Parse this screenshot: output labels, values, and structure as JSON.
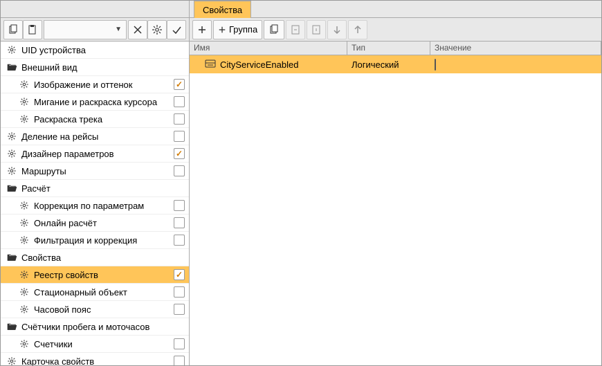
{
  "tabs": {
    "properties": "Свойства"
  },
  "leftToolbar": {
    "comboValue": ""
  },
  "rightToolbar": {
    "group": "Группа"
  },
  "tree": [
    {
      "icon": "gear",
      "label": "UID устройства",
      "indent": 0,
      "chk": null
    },
    {
      "icon": "folder-open",
      "label": "Внешний вид",
      "indent": 0,
      "chk": null
    },
    {
      "icon": "gear",
      "label": "Изображение и оттенок",
      "indent": 1,
      "chk": true
    },
    {
      "icon": "gear",
      "label": "Мигание и раскраска курсора",
      "indent": 1,
      "chk": false
    },
    {
      "icon": "gear",
      "label": "Раскраска трека",
      "indent": 1,
      "chk": false
    },
    {
      "icon": "gear",
      "label": "Деление на рейсы",
      "indent": 0,
      "chk": false
    },
    {
      "icon": "gear",
      "label": "Дизайнер параметров",
      "indent": 0,
      "chk": true
    },
    {
      "icon": "gear",
      "label": "Маршруты",
      "indent": 0,
      "chk": false
    },
    {
      "icon": "folder-open",
      "label": "Расчёт",
      "indent": 0,
      "chk": null
    },
    {
      "icon": "gear",
      "label": "Коррекция по параметрам",
      "indent": 1,
      "chk": false
    },
    {
      "icon": "gear",
      "label": "Онлайн расчёт",
      "indent": 1,
      "chk": false
    },
    {
      "icon": "gear",
      "label": "Фильтрация и коррекция",
      "indent": 1,
      "chk": false
    },
    {
      "icon": "folder-open",
      "label": "Свойства",
      "indent": 0,
      "chk": null
    },
    {
      "icon": "gear",
      "label": "Реестр свойств",
      "indent": 1,
      "chk": true,
      "selected": true
    },
    {
      "icon": "gear",
      "label": "Стационарный объект",
      "indent": 1,
      "chk": false
    },
    {
      "icon": "gear",
      "label": "Часовой пояс",
      "indent": 1,
      "chk": false
    },
    {
      "icon": "folder-open",
      "label": "Счётчики пробега и моточасов",
      "indent": 0,
      "chk": null
    },
    {
      "icon": "gear",
      "label": "Счетчики",
      "indent": 1,
      "chk": false
    },
    {
      "icon": "gear",
      "label": "Карточка свойств",
      "indent": 0,
      "chk": false
    }
  ],
  "grid": {
    "headers": {
      "name": "Имя",
      "type": "Тип",
      "value": "Значение"
    },
    "rows": [
      {
        "name": "CityServiceEnabled",
        "type": "Логический",
        "value": false
      }
    ]
  }
}
